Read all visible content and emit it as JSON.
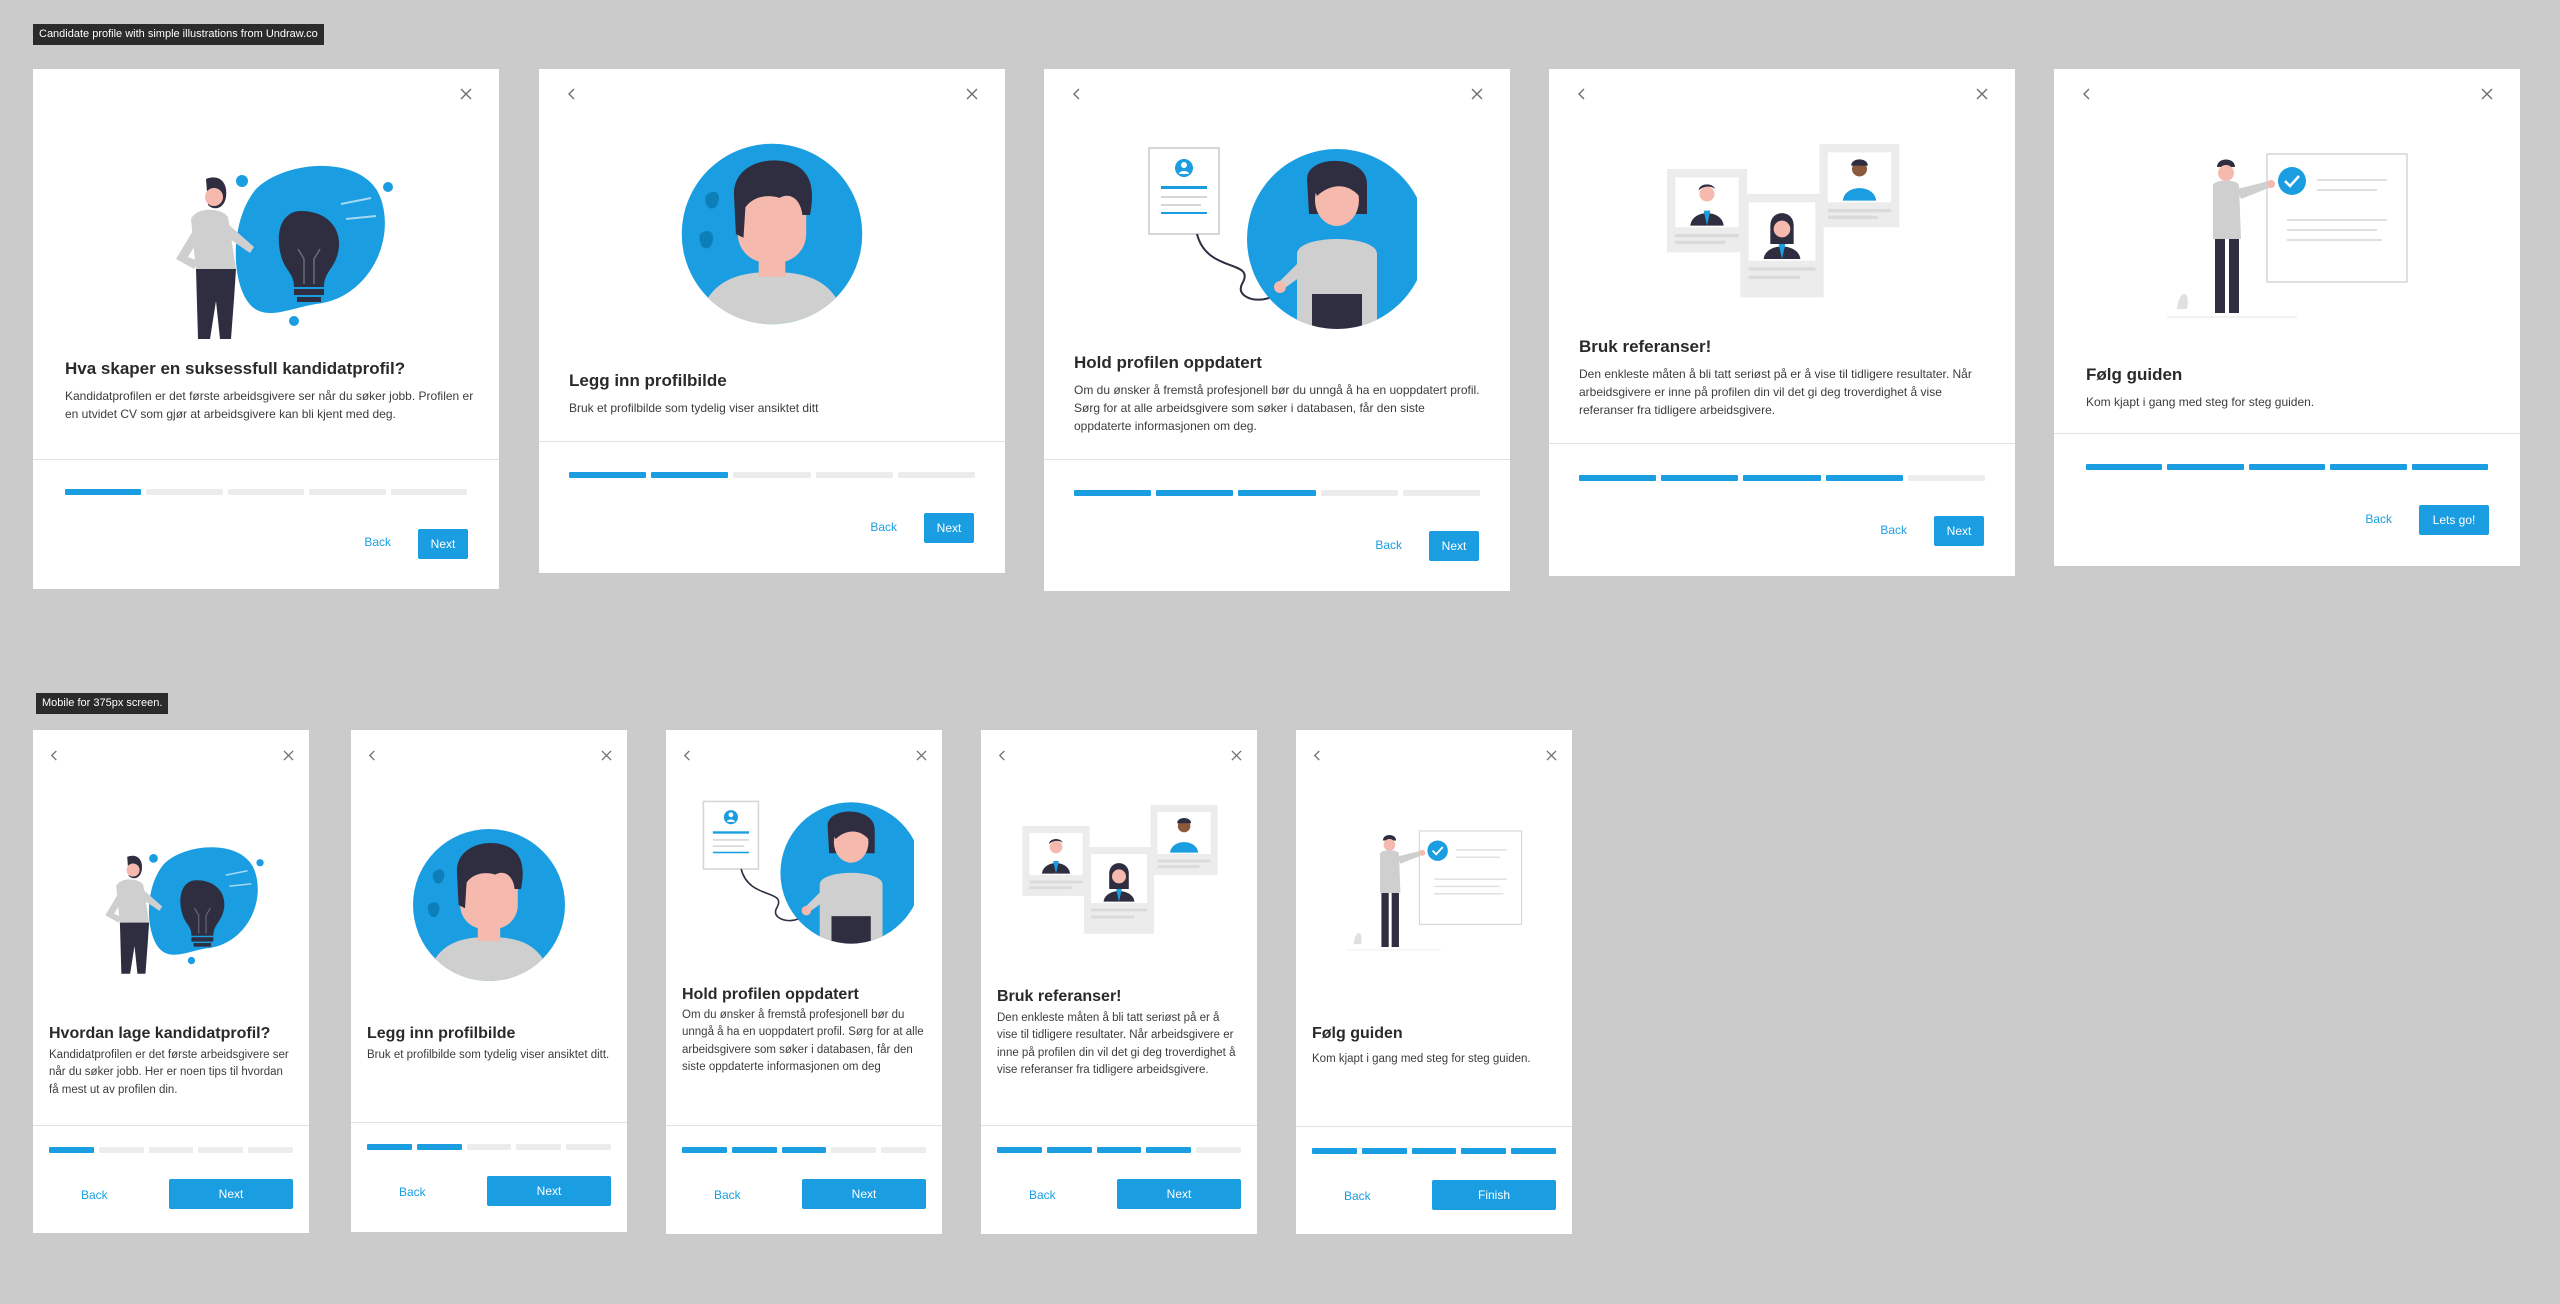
{
  "desktop_label": "Candidate profile with simple illustrations from Undraw.co",
  "mobile_label": "Mobile for 375px screen.",
  "desktop_cards": [
    {
      "title": "Hva skaper en suksessfull kandidatprofil?",
      "body": "Kandidatprofilen er det første arbeidsgivere ser når du søker jobb. Profilen er en utvidet CV som gjør at arbeidsgivere kan bli kjent med deg.",
      "back": "Back",
      "next": "Next",
      "progress": 1
    },
    {
      "title": "Legg inn profilbilde",
      "body": "Bruk et profilbilde som tydelig viser ansiktet ditt",
      "back": "Back",
      "next": "Next",
      "progress": 2
    },
    {
      "title": "Hold profilen oppdatert",
      "body": "Om du ønsker å fremstå profesjonell bør du unngå å ha en uoppdatert profil. Sørg for at alle arbeidsgivere som søker i databasen, får den siste oppdaterte informasjonen om deg.",
      "back": "Back",
      "next": "Next",
      "progress": 3
    },
    {
      "title": "Bruk referanser!",
      "body": "Den enkleste måten å bli tatt seriøst på er å vise til tidligere resultater. Når arbeidsgivere er inne på profilen din vil det gi deg troverdighet å vise referanser fra tidligere arbeidsgivere.",
      "back": "Back",
      "next": "Next",
      "progress": 4
    },
    {
      "title": "Følg guiden",
      "body": "Kom kjapt i gang med steg for steg guiden.",
      "back": "Back",
      "next": "Lets go!",
      "progress": 5
    }
  ],
  "mobile_cards": [
    {
      "title": "Hvordan lage kandidatprofil?",
      "body": "Kandidatprofilen er det første arbeidsgivere ser når du søker jobb. Her er noen tips til hvordan få mest ut av profilen din.",
      "back": "Back",
      "next": "Next",
      "progress": 1
    },
    {
      "title": "Legg inn profilbilde",
      "body": "Bruk et profilbilde som tydelig viser ansiktet ditt.",
      "back": "Back",
      "next": "Next",
      "progress": 2
    },
    {
      "title": "Hold profilen oppdatert",
      "body": "Om du ønsker å fremstå profesjonell bør du unngå å ha en uoppdatert profil. Sørg for at alle arbeidsgivere som søker i databasen, får den siste oppdaterte informasjonen om deg",
      "back": "Back",
      "next": "Next",
      "progress": 3
    },
    {
      "title": "Bruk referanser!",
      "body": "Den enkleste måten å bli tatt seriøst på er å vise til tidligere resultater. Når arbeidsgivere er inne på profilen din vil det gi deg troverdighet å vise referanser fra tidligere arbeidsgivere.",
      "back": "Back",
      "next": "Next",
      "progress": 4
    },
    {
      "title": "Følg guiden",
      "body": "Kom kjapt i gang med steg for steg guiden.",
      "back": "Back",
      "next": "Finish",
      "progress": 5
    }
  ],
  "colors": {
    "accent": "#1a9ee1",
    "background": "#cbcbcb",
    "card": "#ffffff",
    "track": "#ececec"
  }
}
